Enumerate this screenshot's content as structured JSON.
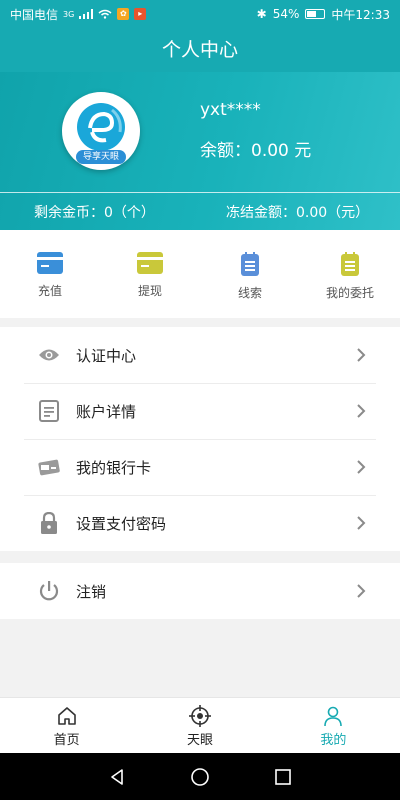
{
  "status_bar": {
    "carrier": "中国电信",
    "network": "3G",
    "battery": "54%",
    "time": "中午12:33"
  },
  "page_title": "个人中心",
  "profile": {
    "avatar_tag": "导享天眼",
    "username": "yxt****",
    "balance_label": "余额：",
    "balance_value": "0.00 元",
    "remaining_coins": "剩余金币：0（个）",
    "frozen_amount": "冻结金额：0.00（元）"
  },
  "quick_actions": [
    {
      "label": "充值",
      "icon": "card-icon",
      "color": "#3a8fd9"
    },
    {
      "label": "提现",
      "icon": "card-icon",
      "color": "#c9c83a"
    },
    {
      "label": "线索",
      "icon": "notepad-icon",
      "color": "#5a8fd9"
    },
    {
      "label": "我的委托",
      "icon": "notepad-icon",
      "color": "#c9c83a"
    }
  ],
  "menu": [
    {
      "label": "认证中心",
      "icon": "eye-icon"
    },
    {
      "label": "账户详情",
      "icon": "document-icon"
    },
    {
      "label": "我的银行卡",
      "icon": "bank-card-icon"
    },
    {
      "label": "设置支付密码",
      "icon": "lock-icon"
    }
  ],
  "logout": {
    "label": "注销",
    "icon": "power-icon"
  },
  "tabs": [
    {
      "label": "首页",
      "icon": "home-icon",
      "active": false
    },
    {
      "label": "天眼",
      "icon": "crosshair-icon",
      "active": false
    },
    {
      "label": "我的",
      "icon": "person-icon",
      "active": true
    }
  ],
  "colors": {
    "primary": "#17aab2",
    "active_tab": "#17aab2"
  }
}
